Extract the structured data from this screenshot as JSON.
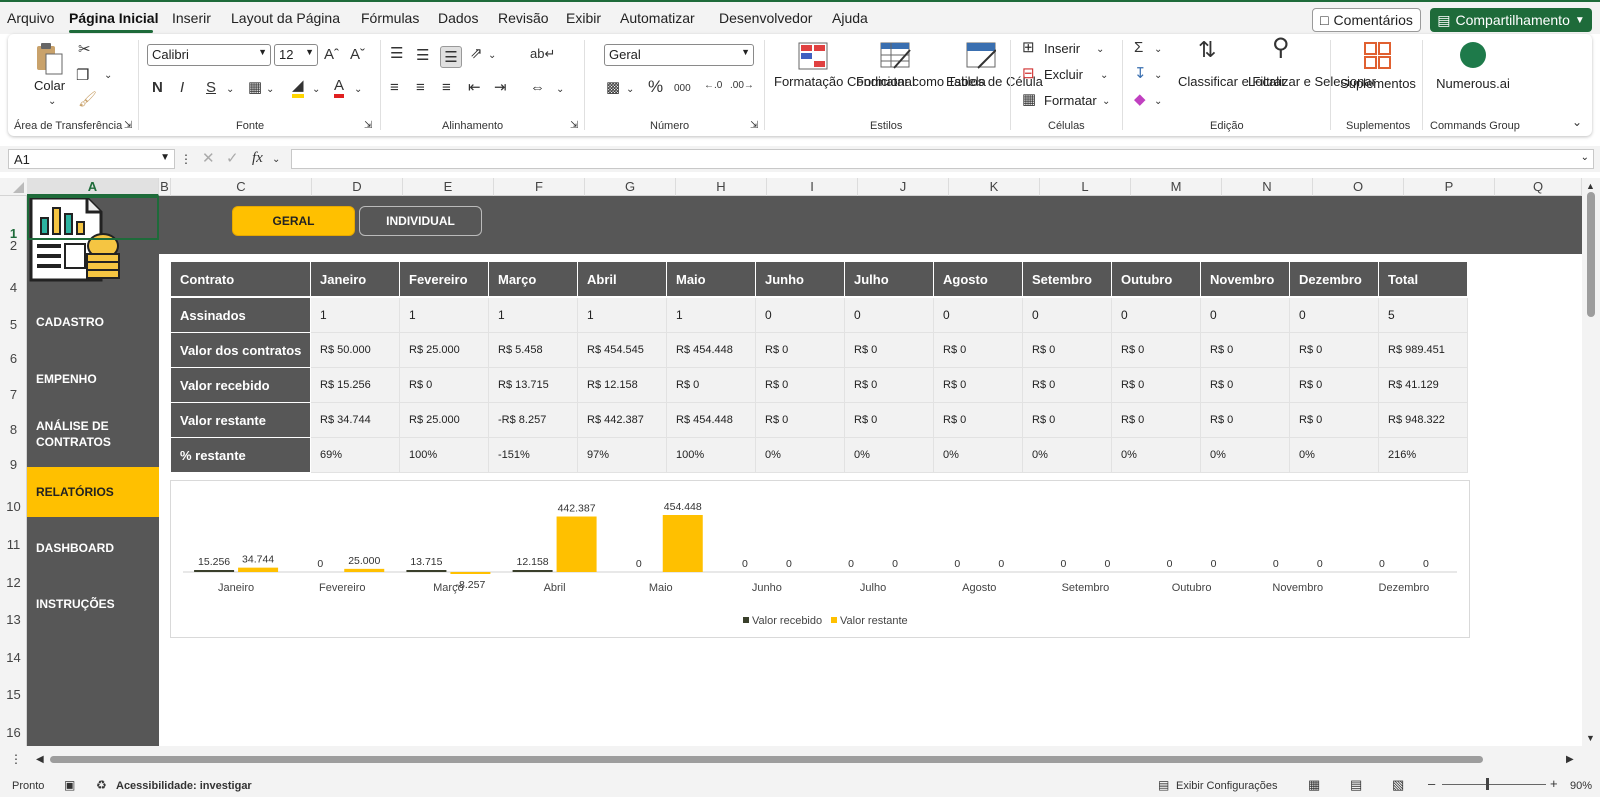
{
  "menu": {
    "items": [
      "Arquivo",
      "Página Inicial",
      "Inserir",
      "Layout da Página",
      "Fórmulas",
      "Dados",
      "Revisão",
      "Exibir",
      "Automatizar",
      "Desenvolvedor",
      "Ajuda"
    ],
    "comments_label": "Comentários",
    "share_label": "Compartilhamento"
  },
  "ribbon": {
    "paste_label": "Colar",
    "clipboard_group": "Área de Transferência",
    "font_name": "Calibri",
    "font_size": "12",
    "font_group": "Fonte",
    "alignment_group": "Alinhamento",
    "number_format": "Geral",
    "number_group": "Número",
    "conditional_formatting": "Formatação Condicional",
    "format_as_table": "Formatar como Tabela",
    "cell_styles": "Estilos de Célula",
    "styles_group": "Estilos",
    "insert_label": "Inserir",
    "delete_label": "Excluir",
    "format_label": "Formatar",
    "cells_group": "Células",
    "sort_filter": "Classificar e Filtrar",
    "find_select": "Localizar e Selecionar",
    "editing_group": "Edição",
    "addins_label": "Suplementos",
    "addins_group": "Suplementos",
    "numerous_label": "Numerous.ai",
    "commands_group": "Commands Group",
    "accent_green": "#1e6b3a"
  },
  "formula_bar": {
    "name_box": "A1",
    "fx": "fx",
    "content": ""
  },
  "columns": [
    "A",
    "B",
    "C",
    "D",
    "E",
    "F",
    "G",
    "H",
    "I",
    "J",
    "K",
    "L",
    "M",
    "N",
    "O",
    "P",
    "Q"
  ],
  "rows": [
    "1",
    "2",
    "4",
    "5",
    "6",
    "7",
    "8",
    "9",
    "10",
    "11",
    "12",
    "13",
    "14",
    "15",
    "16"
  ],
  "sidebar": {
    "items": [
      "CADASTRO",
      "EMPENHO",
      "ANÁLISE DE CONTRATOS",
      "RELATÓRIOS",
      "DASHBOARD",
      "INSTRUÇÕES"
    ],
    "active": "RELATÓRIOS",
    "bg_color": "#575757",
    "active_color": "#ffc000"
  },
  "tabs": {
    "geral": "GERAL",
    "individual": "INDIVIDUAL"
  },
  "table": {
    "headers": [
      "Contrato",
      "Janeiro",
      "Fevereiro",
      "Março",
      "Abril",
      "Maio",
      "Junho",
      "Julho",
      "Agosto",
      "Setembro",
      "Outubro",
      "Novembro",
      "Dezembro",
      "Total"
    ],
    "rows": [
      {
        "label": "Assinados",
        "values": [
          "1",
          "1",
          "1",
          "1",
          "1",
          "0",
          "0",
          "0",
          "0",
          "0",
          "0",
          "0",
          "5"
        ]
      },
      {
        "label": "Valor dos contratos",
        "values": [
          "R$ 50.000",
          "R$ 25.000",
          "R$ 5.458",
          "R$ 454.545",
          "R$ 454.448",
          "R$ 0",
          "R$ 0",
          "R$ 0",
          "R$ 0",
          "R$ 0",
          "R$ 0",
          "R$ 0",
          "R$ 989.451"
        ]
      },
      {
        "label": "Valor recebido",
        "values": [
          "R$ 15.256",
          "R$ 0",
          "R$ 13.715",
          "R$ 12.158",
          "R$ 0",
          "R$ 0",
          "R$ 0",
          "R$ 0",
          "R$ 0",
          "R$ 0",
          "R$ 0",
          "R$ 0",
          "R$ 41.129"
        ]
      },
      {
        "label": "Valor restante",
        "values": [
          "R$ 34.744",
          "R$ 25.000",
          "-R$ 8.257",
          "R$ 442.387",
          "R$ 454.448",
          "R$ 0",
          "R$ 0",
          "R$ 0",
          "R$ 0",
          "R$ 0",
          "R$ 0",
          "R$ 0",
          "R$ 948.322"
        ]
      },
      {
        "label": "% restante",
        "values": [
          "69%",
          "100%",
          "-151%",
          "97%",
          "100%",
          "0%",
          "0%",
          "0%",
          "0%",
          "0%",
          "0%",
          "0%",
          "216%"
        ]
      }
    ]
  },
  "chart_data": {
    "type": "bar",
    "categories": [
      "Janeiro",
      "Fevereiro",
      "Março",
      "Abril",
      "Maio",
      "Junho",
      "Julho",
      "Agosto",
      "Setembro",
      "Outubro",
      "Novembro",
      "Dezembro"
    ],
    "series": [
      {
        "name": "Valor recebido",
        "color": "#3a3f2b",
        "values": [
          15256,
          0,
          13715,
          12158,
          0,
          0,
          0,
          0,
          0,
          0,
          0,
          0
        ],
        "labels": [
          "15.256",
          "0",
          "13.715",
          "12.158",
          "0",
          "0",
          "0",
          "0",
          "0",
          "0",
          "0",
          "0"
        ]
      },
      {
        "name": "Valor restante",
        "color": "#ffc000",
        "values": [
          34744,
          25000,
          -8257,
          442387,
          454448,
          0,
          0,
          0,
          0,
          0,
          0,
          0
        ],
        "labels": [
          "34.744",
          "25.000",
          "-8.257",
          "442.387",
          "454.448",
          "0",
          "0",
          "0",
          "0",
          "0",
          "0",
          "0"
        ]
      }
    ],
    "legend": "bottom",
    "grid": false
  },
  "status": {
    "ready": "Pronto",
    "accessibility": "Acessibilidade: investigar",
    "display_settings": "Exibir Configurações",
    "zoom": "90%"
  }
}
